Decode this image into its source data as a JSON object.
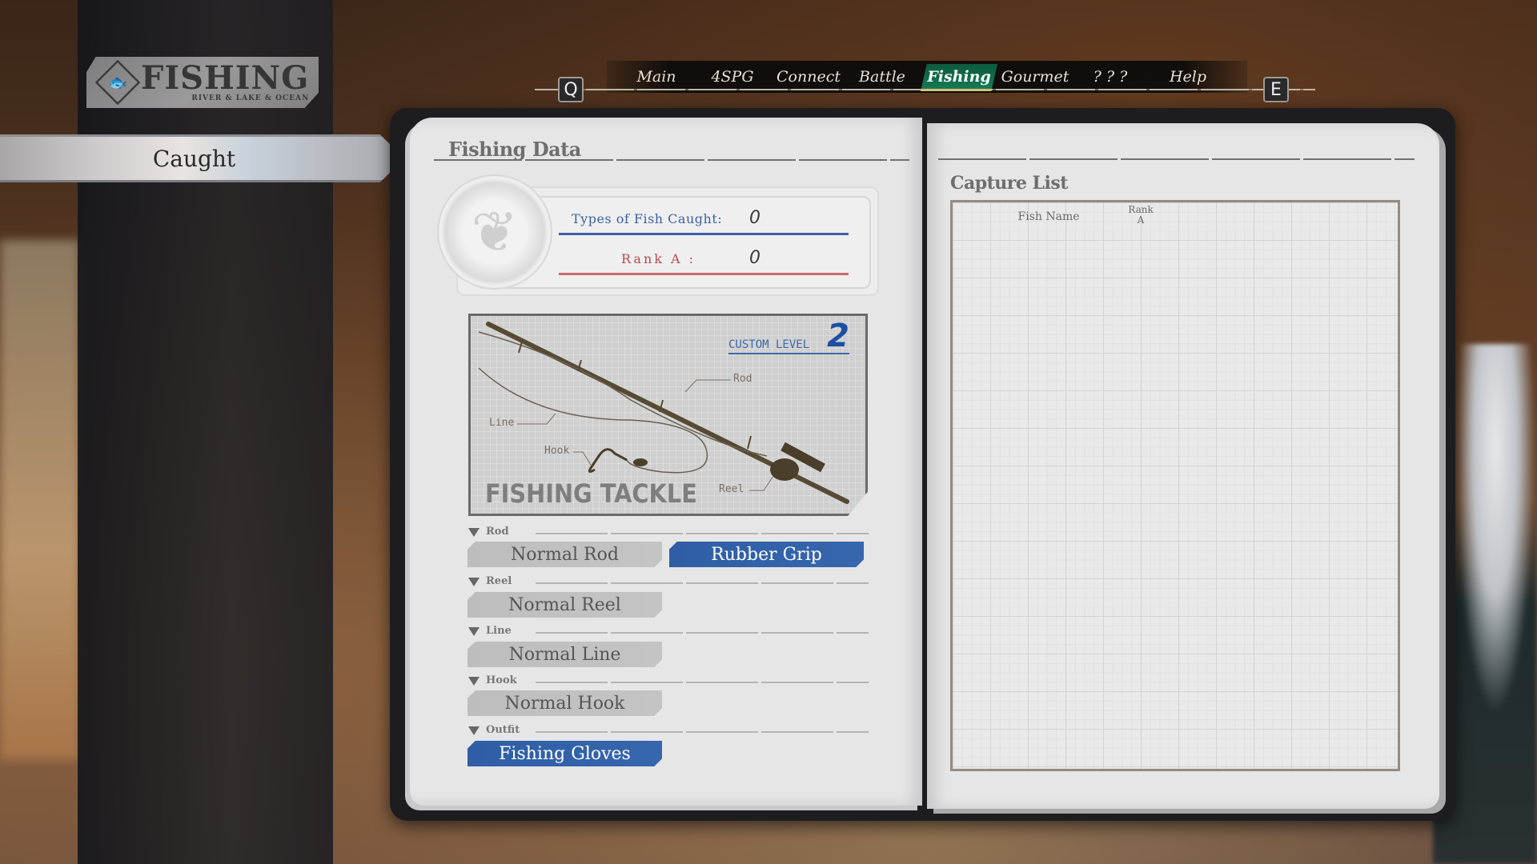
{
  "logo": {
    "title": "FISHING",
    "subtitle": "RIVER & LAKE & OCEAN",
    "emblem": "fish-hook-emblem"
  },
  "sidebar": {
    "selected_item": "Caught"
  },
  "nav": {
    "prev_key": "Q",
    "next_key": "E",
    "tabs": [
      {
        "label": "Main",
        "active": false
      },
      {
        "label": "4SPG",
        "active": false
      },
      {
        "label": "Connect",
        "active": false
      },
      {
        "label": "Battle",
        "active": false
      },
      {
        "label": "Fishing",
        "active": true
      },
      {
        "label": "Gourmet",
        "active": false
      },
      {
        "label": "? ? ?",
        "active": false
      },
      {
        "label": "Help",
        "active": false
      }
    ],
    "active_color": "#147a54"
  },
  "left_page": {
    "title": "Fishing Data",
    "stats": {
      "types_label": "Types of Fish Caught:",
      "types_value": "0",
      "rank_label": "Rank A :",
      "rank_value": "0",
      "types_color": "#3a62a6",
      "rank_color": "#b84a4a"
    },
    "tackle": {
      "title": "FISHING TACKLE",
      "custom_level_label": "CUSTOM LEVEL",
      "custom_level_value": "2",
      "parts": {
        "rod": "Rod",
        "line": "Line",
        "hook": "Hook",
        "reel": "Reel"
      }
    },
    "categories": [
      {
        "label": "Rod",
        "items": [
          {
            "label": "Normal Rod",
            "style": "normal"
          },
          {
            "label": "Rubber Grip",
            "style": "special"
          }
        ]
      },
      {
        "label": "Reel",
        "items": [
          {
            "label": "Normal Reel",
            "style": "normal"
          }
        ]
      },
      {
        "label": "Line",
        "items": [
          {
            "label": "Normal Line",
            "style": "normal"
          }
        ]
      },
      {
        "label": "Hook",
        "items": [
          {
            "label": "Normal Hook",
            "style": "normal"
          }
        ]
      },
      {
        "label": "Outfit",
        "items": [
          {
            "label": "Fishing Gloves",
            "style": "special"
          }
        ]
      }
    ]
  },
  "right_page": {
    "title": "Capture List",
    "columns": {
      "fish_name": "Fish Name",
      "rank_line1": "Rank",
      "rank_line2": "A"
    },
    "rows": []
  }
}
